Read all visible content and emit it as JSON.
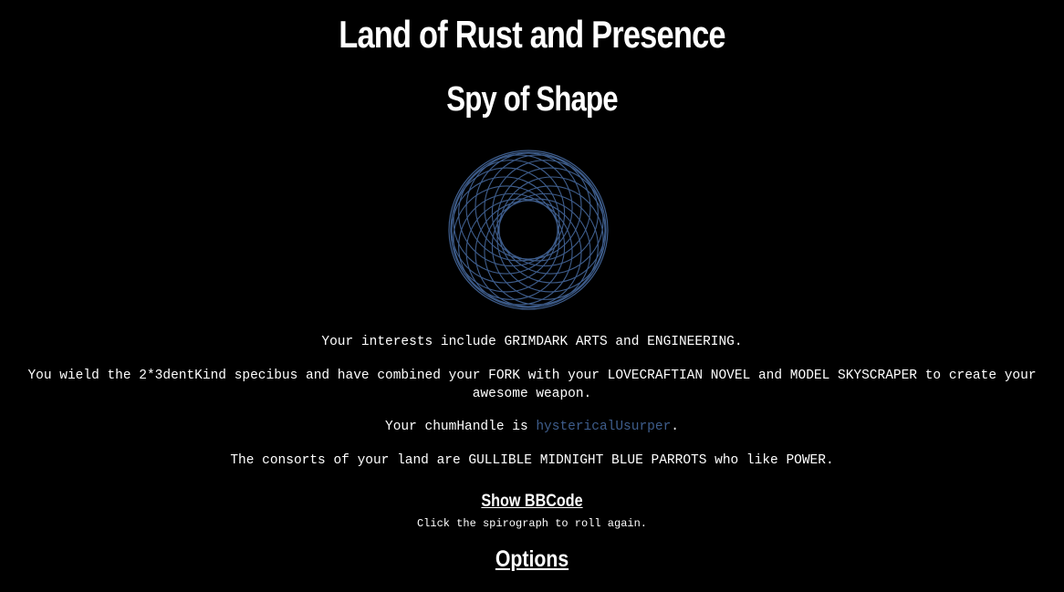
{
  "header": {
    "title": "Land of Rust and Presence",
    "subtitle": "Spy of Shape"
  },
  "spirograph": {
    "icon": "spirograph-icon",
    "color": "#3e5d8c"
  },
  "details": {
    "interests": "Your interests include GRIMDARK ARTS and ENGINEERING.",
    "weapon": "You wield the 2*3dentKind specibus and have combined your FORK with your LOVECRAFTIAN NOVEL and MODEL SKYSCRAPER to create your awesome weapon.",
    "chum_prefix": "Your chumHandle is ",
    "chum_handle": "hystericalUsurper",
    "chum_suffix": ".",
    "consorts": "The consorts of your land are GULLIBLE MIDNIGHT BLUE PARROTS who like POWER."
  },
  "actions": {
    "show_bbcode": "Show BBCode",
    "hint": "Click the spirograph to roll again.",
    "options": "Options"
  },
  "colors": {
    "background": "#000000",
    "text": "#ffffff",
    "accent": "#3e5d8c"
  }
}
